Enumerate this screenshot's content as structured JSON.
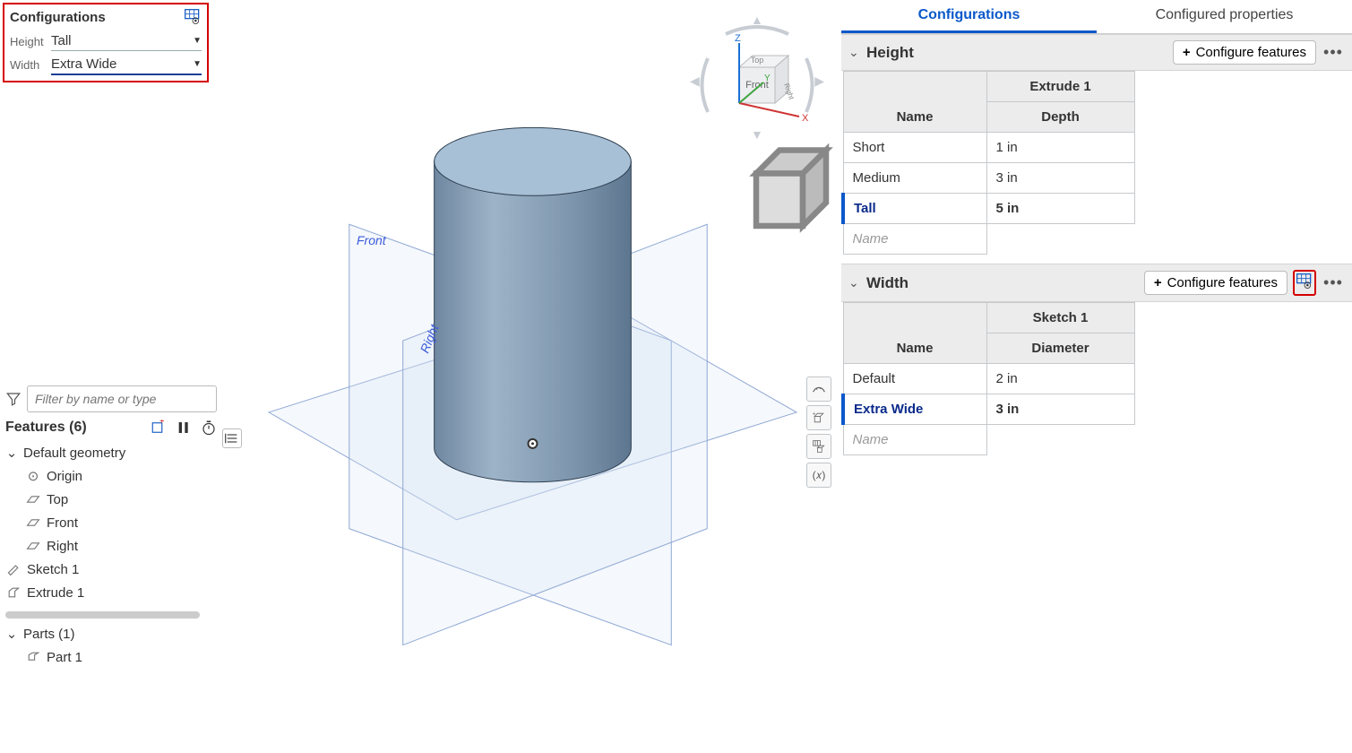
{
  "config_float": {
    "title": "Configurations",
    "rows": [
      {
        "label": "Height",
        "value": "Tall"
      },
      {
        "label": "Width",
        "value": "Extra Wide"
      }
    ]
  },
  "filter": {
    "placeholder": "Filter by name or type"
  },
  "features": {
    "title": "Features (6)",
    "default_geometry": "Default geometry",
    "origin": "Origin",
    "top": "Top",
    "front": "Front",
    "right": "Right",
    "sketch": "Sketch 1",
    "extrude": "Extrude 1"
  },
  "parts": {
    "title": "Parts (1)",
    "part": "Part 1"
  },
  "navcube": {
    "top": "Top",
    "front": "Front",
    "right": "Right",
    "x": "X",
    "y": "Y",
    "z": "Z"
  },
  "viewport_labels": {
    "front": "Front",
    "right": "Right"
  },
  "right_panel": {
    "tabs": {
      "config": "Configurations",
      "props": "Configured properties"
    },
    "configure_button": "Configure features",
    "height_section": {
      "title": "Height",
      "feature": "Extrude 1",
      "param": "Depth",
      "name_header": "Name",
      "rows": [
        {
          "name": "Short",
          "value": "1 in"
        },
        {
          "name": "Medium",
          "value": "3 in"
        },
        {
          "name": "Tall",
          "value": "5 in"
        }
      ],
      "placeholder": "Name"
    },
    "width_section": {
      "title": "Width",
      "feature": "Sketch 1",
      "param": "Diameter",
      "name_header": "Name",
      "rows": [
        {
          "name": "Default",
          "value": "2 in"
        },
        {
          "name": "Extra Wide",
          "value": "3 in"
        }
      ],
      "placeholder": "Name"
    }
  }
}
